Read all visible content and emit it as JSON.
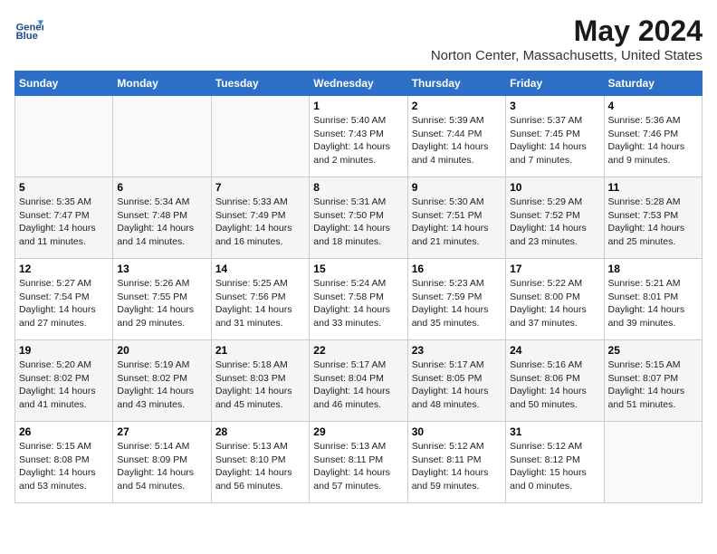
{
  "logo": {
    "line1": "General",
    "line2": "Blue"
  },
  "title": "May 2024",
  "subtitle": "Norton Center, Massachusetts, United States",
  "headers": [
    "Sunday",
    "Monday",
    "Tuesday",
    "Wednesday",
    "Thursday",
    "Friday",
    "Saturday"
  ],
  "weeks": [
    [
      {
        "day": "",
        "info": ""
      },
      {
        "day": "",
        "info": ""
      },
      {
        "day": "",
        "info": ""
      },
      {
        "day": "1",
        "info": "Sunrise: 5:40 AM\nSunset: 7:43 PM\nDaylight: 14 hours\nand 2 minutes."
      },
      {
        "day": "2",
        "info": "Sunrise: 5:39 AM\nSunset: 7:44 PM\nDaylight: 14 hours\nand 4 minutes."
      },
      {
        "day": "3",
        "info": "Sunrise: 5:37 AM\nSunset: 7:45 PM\nDaylight: 14 hours\nand 7 minutes."
      },
      {
        "day": "4",
        "info": "Sunrise: 5:36 AM\nSunset: 7:46 PM\nDaylight: 14 hours\nand 9 minutes."
      }
    ],
    [
      {
        "day": "5",
        "info": "Sunrise: 5:35 AM\nSunset: 7:47 PM\nDaylight: 14 hours\nand 11 minutes."
      },
      {
        "day": "6",
        "info": "Sunrise: 5:34 AM\nSunset: 7:48 PM\nDaylight: 14 hours\nand 14 minutes."
      },
      {
        "day": "7",
        "info": "Sunrise: 5:33 AM\nSunset: 7:49 PM\nDaylight: 14 hours\nand 16 minutes."
      },
      {
        "day": "8",
        "info": "Sunrise: 5:31 AM\nSunset: 7:50 PM\nDaylight: 14 hours\nand 18 minutes."
      },
      {
        "day": "9",
        "info": "Sunrise: 5:30 AM\nSunset: 7:51 PM\nDaylight: 14 hours\nand 21 minutes."
      },
      {
        "day": "10",
        "info": "Sunrise: 5:29 AM\nSunset: 7:52 PM\nDaylight: 14 hours\nand 23 minutes."
      },
      {
        "day": "11",
        "info": "Sunrise: 5:28 AM\nSunset: 7:53 PM\nDaylight: 14 hours\nand 25 minutes."
      }
    ],
    [
      {
        "day": "12",
        "info": "Sunrise: 5:27 AM\nSunset: 7:54 PM\nDaylight: 14 hours\nand 27 minutes."
      },
      {
        "day": "13",
        "info": "Sunrise: 5:26 AM\nSunset: 7:55 PM\nDaylight: 14 hours\nand 29 minutes."
      },
      {
        "day": "14",
        "info": "Sunrise: 5:25 AM\nSunset: 7:56 PM\nDaylight: 14 hours\nand 31 minutes."
      },
      {
        "day": "15",
        "info": "Sunrise: 5:24 AM\nSunset: 7:58 PM\nDaylight: 14 hours\nand 33 minutes."
      },
      {
        "day": "16",
        "info": "Sunrise: 5:23 AM\nSunset: 7:59 PM\nDaylight: 14 hours\nand 35 minutes."
      },
      {
        "day": "17",
        "info": "Sunrise: 5:22 AM\nSunset: 8:00 PM\nDaylight: 14 hours\nand 37 minutes."
      },
      {
        "day": "18",
        "info": "Sunrise: 5:21 AM\nSunset: 8:01 PM\nDaylight: 14 hours\nand 39 minutes."
      }
    ],
    [
      {
        "day": "19",
        "info": "Sunrise: 5:20 AM\nSunset: 8:02 PM\nDaylight: 14 hours\nand 41 minutes."
      },
      {
        "day": "20",
        "info": "Sunrise: 5:19 AM\nSunset: 8:02 PM\nDaylight: 14 hours\nand 43 minutes."
      },
      {
        "day": "21",
        "info": "Sunrise: 5:18 AM\nSunset: 8:03 PM\nDaylight: 14 hours\nand 45 minutes."
      },
      {
        "day": "22",
        "info": "Sunrise: 5:17 AM\nSunset: 8:04 PM\nDaylight: 14 hours\nand 46 minutes."
      },
      {
        "day": "23",
        "info": "Sunrise: 5:17 AM\nSunset: 8:05 PM\nDaylight: 14 hours\nand 48 minutes."
      },
      {
        "day": "24",
        "info": "Sunrise: 5:16 AM\nSunset: 8:06 PM\nDaylight: 14 hours\nand 50 minutes."
      },
      {
        "day": "25",
        "info": "Sunrise: 5:15 AM\nSunset: 8:07 PM\nDaylight: 14 hours\nand 51 minutes."
      }
    ],
    [
      {
        "day": "26",
        "info": "Sunrise: 5:15 AM\nSunset: 8:08 PM\nDaylight: 14 hours\nand 53 minutes."
      },
      {
        "day": "27",
        "info": "Sunrise: 5:14 AM\nSunset: 8:09 PM\nDaylight: 14 hours\nand 54 minutes."
      },
      {
        "day": "28",
        "info": "Sunrise: 5:13 AM\nSunset: 8:10 PM\nDaylight: 14 hours\nand 56 minutes."
      },
      {
        "day": "29",
        "info": "Sunrise: 5:13 AM\nSunset: 8:11 PM\nDaylight: 14 hours\nand 57 minutes."
      },
      {
        "day": "30",
        "info": "Sunrise: 5:12 AM\nSunset: 8:11 PM\nDaylight: 14 hours\nand 59 minutes."
      },
      {
        "day": "31",
        "info": "Sunrise: 5:12 AM\nSunset: 8:12 PM\nDaylight: 15 hours\nand 0 minutes."
      },
      {
        "day": "",
        "info": ""
      }
    ]
  ],
  "colors": {
    "header_bg": "#2d6ec7",
    "header_text": "#ffffff",
    "accent": "#1a4b8c"
  }
}
